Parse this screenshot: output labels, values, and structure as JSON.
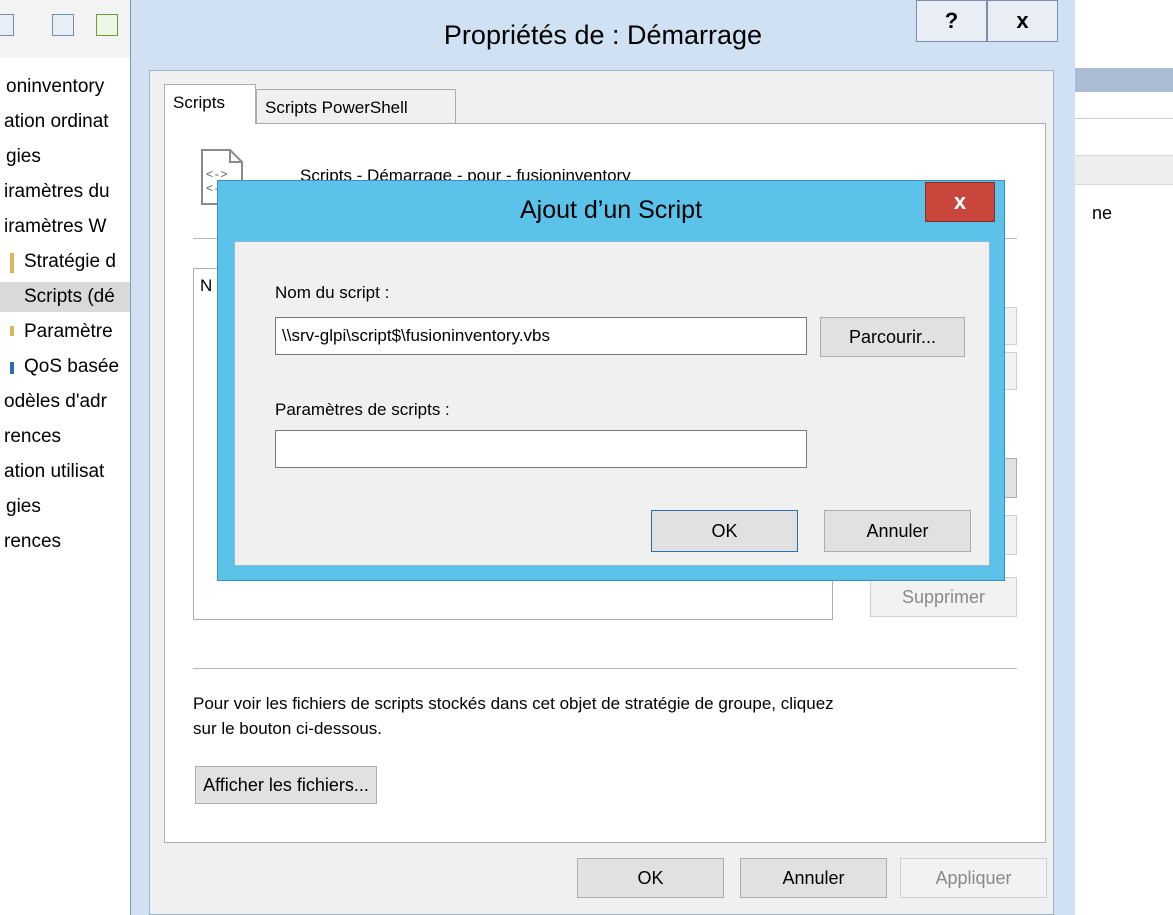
{
  "background": {
    "tree_items": [
      "oninventory",
      "ation ordinat",
      "gies",
      "iramètres du",
      "iramètres W",
      "Stratégie d",
      "Scripts (dé",
      "Paramètre",
      "QoS basée",
      "odèles d'adr",
      "rences",
      "ation utilisat",
      "gies",
      "rences"
    ],
    "right_text": "ne"
  },
  "main_dialog": {
    "title": "Propriétés de : Démarrage",
    "help_label": "?",
    "close_label": "x",
    "tabs": [
      "Scripts",
      "Scripts PowerShell"
    ],
    "header_text": "Scripts - Démarrage - pour - fusioninventory",
    "list_column": "N",
    "side_buttons": [
      "",
      "",
      "",
      "",
      "Supprimer"
    ],
    "info_line1": "Pour voir les fichiers de scripts stockés dans cet objet de stratégie de groupe, cliquez",
    "info_line2": "sur le bouton ci-dessous.",
    "show_files_label": "Afficher les fichiers...",
    "ok_label": "OK",
    "cancel_label": "Annuler",
    "apply_label": "Appliquer"
  },
  "add_dialog": {
    "title": "Ajout d’un Script",
    "close_label": "x",
    "script_name_label": "Nom du script :",
    "script_name_value": "\\\\srv-glpi\\script$\\fusioninventory.vbs",
    "browse_label": "Parcourir...",
    "params_label": "Paramètres de scripts :",
    "params_value": "",
    "ok_label": "OK",
    "cancel_label": "Annuler"
  }
}
